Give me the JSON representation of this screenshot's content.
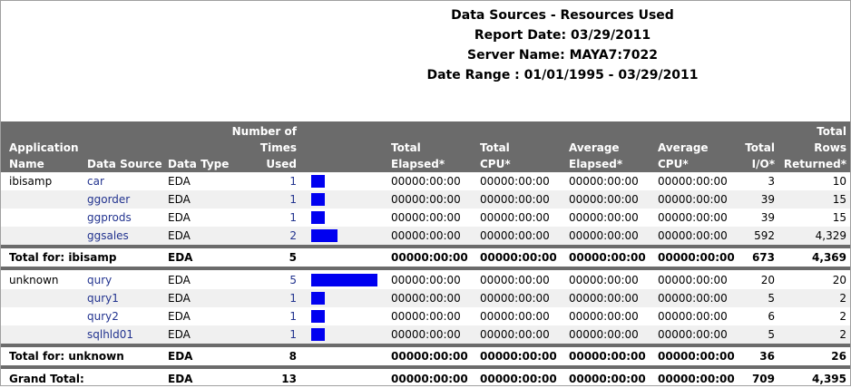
{
  "report": {
    "title": "Data Sources  - Resources Used",
    "report_date": "Report Date:  03/29/2011",
    "server_name": "Server Name: MAYA7:7022",
    "date_range": "Date Range :  01/01/1995 - 03/29/2011"
  },
  "columns": {
    "app_name": "Application\nName",
    "data_source": "Data Source",
    "data_type": "Data Type",
    "times_used": "Number of\nTimes\nUsed",
    "total_elapsed": "Total\nElapsed*",
    "total_cpu": "Total\nCPU*",
    "avg_elapsed": "Average\nElapsed*",
    "avg_cpu": "Average\nCPU*",
    "total_io": "Total\nI/O*",
    "total_rows": "Total\nRows\nReturned*"
  },
  "bar_max": 5,
  "colors": {
    "bar": "#0000f0",
    "header_band": "#6b6b6b",
    "link": "#22338f"
  },
  "groups": [
    {
      "app": "ibisamp",
      "rows": [
        {
          "data_source": "car",
          "data_type": "EDA",
          "times_used": 1,
          "total_elapsed": "00000:00:00",
          "total_cpu": "00000:00:00",
          "avg_elapsed": "00000:00:00",
          "avg_cpu": "00000:00:00",
          "total_io": "3",
          "total_rows": "10"
        },
        {
          "data_source": "ggorder",
          "data_type": "EDA",
          "times_used": 1,
          "total_elapsed": "00000:00:00",
          "total_cpu": "00000:00:00",
          "avg_elapsed": "00000:00:00",
          "avg_cpu": "00000:00:00",
          "total_io": "39",
          "total_rows": "15"
        },
        {
          "data_source": "ggprods",
          "data_type": "EDA",
          "times_used": 1,
          "total_elapsed": "00000:00:00",
          "total_cpu": "00000:00:00",
          "avg_elapsed": "00000:00:00",
          "avg_cpu": "00000:00:00",
          "total_io": "39",
          "total_rows": "15"
        },
        {
          "data_source": "ggsales",
          "data_type": "EDA",
          "times_used": 2,
          "total_elapsed": "00000:00:00",
          "total_cpu": "00000:00:00",
          "avg_elapsed": "00000:00:00",
          "avg_cpu": "00000:00:00",
          "total_io": "592",
          "total_rows": "4,329"
        }
      ],
      "total": {
        "label": "Total for:  ibisamp",
        "data_type": "EDA",
        "times_used": "5",
        "total_elapsed": "00000:00:00",
        "total_cpu": "00000:00:00",
        "avg_elapsed": "00000:00:00",
        "avg_cpu": "00000:00:00",
        "total_io": "673",
        "total_rows": "4,369"
      }
    },
    {
      "app": "unknown",
      "rows": [
        {
          "data_source": "qury",
          "data_type": "EDA",
          "times_used": 5,
          "total_elapsed": "00000:00:00",
          "total_cpu": "00000:00:00",
          "avg_elapsed": "00000:00:00",
          "avg_cpu": "00000:00:00",
          "total_io": "20",
          "total_rows": "20"
        },
        {
          "data_source": "qury1",
          "data_type": "EDA",
          "times_used": 1,
          "total_elapsed": "00000:00:00",
          "total_cpu": "00000:00:00",
          "avg_elapsed": "00000:00:00",
          "avg_cpu": "00000:00:00",
          "total_io": "5",
          "total_rows": "2"
        },
        {
          "data_source": "qury2",
          "data_type": "EDA",
          "times_used": 1,
          "total_elapsed": "00000:00:00",
          "total_cpu": "00000:00:00",
          "avg_elapsed": "00000:00:00",
          "avg_cpu": "00000:00:00",
          "total_io": "6",
          "total_rows": "2"
        },
        {
          "data_source": "sqlhld01",
          "data_type": "EDA",
          "times_used": 1,
          "total_elapsed": "00000:00:00",
          "total_cpu": "00000:00:00",
          "avg_elapsed": "00000:00:00",
          "avg_cpu": "00000:00:00",
          "total_io": "5",
          "total_rows": "2"
        }
      ],
      "total": {
        "label": "Total for:  unknown",
        "data_type": "EDA",
        "times_used": "8",
        "total_elapsed": "00000:00:00",
        "total_cpu": "00000:00:00",
        "avg_elapsed": "00000:00:00",
        "avg_cpu": "00000:00:00",
        "total_io": "36",
        "total_rows": "26"
      }
    }
  ],
  "grand_total": {
    "label": "Grand Total:",
    "data_type": "EDA",
    "times_used": "13",
    "total_elapsed": "00000:00:00",
    "total_cpu": "00000:00:00",
    "avg_elapsed": "00000:00:00",
    "avg_cpu": "00000:00:00",
    "total_io": "709",
    "total_rows": "4,395"
  }
}
